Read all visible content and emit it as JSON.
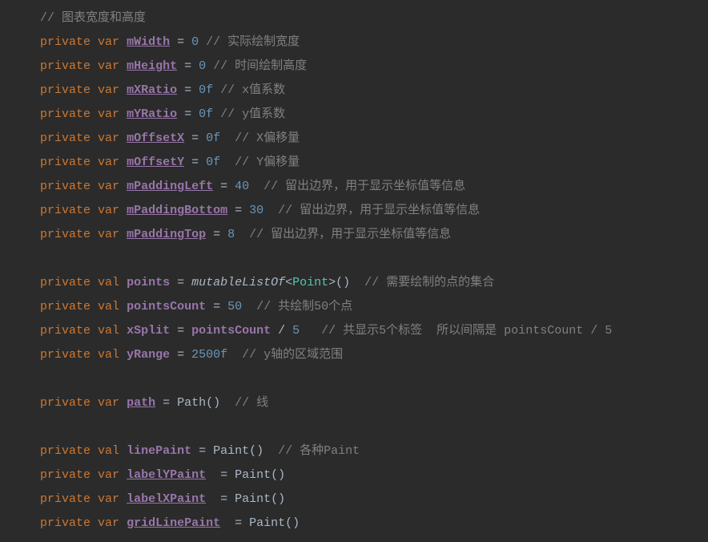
{
  "lines": [
    {
      "segments": [
        {
          "text": "// 图表宽度和高度",
          "cls": "comment"
        }
      ]
    },
    {
      "segments": [
        {
          "text": "private",
          "cls": "keyword"
        },
        {
          "text": " ",
          "cls": ""
        },
        {
          "text": "var",
          "cls": "keyword"
        },
        {
          "text": " ",
          "cls": ""
        },
        {
          "text": "mWidth",
          "cls": "purple underline bold"
        },
        {
          "text": " = ",
          "cls": "equals"
        },
        {
          "text": "0",
          "cls": "number"
        },
        {
          "text": " ",
          "cls": ""
        },
        {
          "text": "// 实际绘制宽度",
          "cls": "comment"
        }
      ]
    },
    {
      "segments": [
        {
          "text": "private",
          "cls": "keyword"
        },
        {
          "text": " ",
          "cls": ""
        },
        {
          "text": "var",
          "cls": "keyword"
        },
        {
          "text": " ",
          "cls": ""
        },
        {
          "text": "mHeight",
          "cls": "purple underline bold"
        },
        {
          "text": " = ",
          "cls": "equals"
        },
        {
          "text": "0",
          "cls": "number"
        },
        {
          "text": " ",
          "cls": ""
        },
        {
          "text": "// 时间绘制高度",
          "cls": "comment"
        }
      ]
    },
    {
      "segments": [
        {
          "text": "private",
          "cls": "keyword"
        },
        {
          "text": " ",
          "cls": ""
        },
        {
          "text": "var",
          "cls": "keyword"
        },
        {
          "text": " ",
          "cls": ""
        },
        {
          "text": "mXRatio",
          "cls": "purple underline bold"
        },
        {
          "text": " = ",
          "cls": "equals"
        },
        {
          "text": "0f",
          "cls": "number"
        },
        {
          "text": " ",
          "cls": ""
        },
        {
          "text": "// x值系数",
          "cls": "comment"
        }
      ]
    },
    {
      "segments": [
        {
          "text": "private",
          "cls": "keyword"
        },
        {
          "text": " ",
          "cls": ""
        },
        {
          "text": "var",
          "cls": "keyword"
        },
        {
          "text": " ",
          "cls": ""
        },
        {
          "text": "mYRatio",
          "cls": "purple underline bold"
        },
        {
          "text": " = ",
          "cls": "equals"
        },
        {
          "text": "0f",
          "cls": "number"
        },
        {
          "text": " ",
          "cls": ""
        },
        {
          "text": "// y值系数",
          "cls": "comment"
        }
      ]
    },
    {
      "segments": [
        {
          "text": "private",
          "cls": "keyword"
        },
        {
          "text": " ",
          "cls": ""
        },
        {
          "text": "var",
          "cls": "keyword"
        },
        {
          "text": " ",
          "cls": ""
        },
        {
          "text": "mOffsetX",
          "cls": "purple underline bold"
        },
        {
          "text": " = ",
          "cls": "equals"
        },
        {
          "text": "0f",
          "cls": "number"
        },
        {
          "text": "  ",
          "cls": ""
        },
        {
          "text": "// X偏移量",
          "cls": "comment"
        }
      ]
    },
    {
      "segments": [
        {
          "text": "private",
          "cls": "keyword"
        },
        {
          "text": " ",
          "cls": ""
        },
        {
          "text": "var",
          "cls": "keyword"
        },
        {
          "text": " ",
          "cls": ""
        },
        {
          "text": "mOffsetY",
          "cls": "purple underline bold"
        },
        {
          "text": " = ",
          "cls": "equals"
        },
        {
          "text": "0f",
          "cls": "number"
        },
        {
          "text": "  ",
          "cls": ""
        },
        {
          "text": "// Y偏移量",
          "cls": "comment"
        }
      ]
    },
    {
      "segments": [
        {
          "text": "private",
          "cls": "keyword"
        },
        {
          "text": " ",
          "cls": ""
        },
        {
          "text": "var",
          "cls": "keyword"
        },
        {
          "text": " ",
          "cls": ""
        },
        {
          "text": "mPaddingLeft",
          "cls": "purple underline bold"
        },
        {
          "text": " = ",
          "cls": "equals"
        },
        {
          "text": "40",
          "cls": "number"
        },
        {
          "text": "  ",
          "cls": ""
        },
        {
          "text": "// 留出边界，用于显示坐标值等信息",
          "cls": "comment"
        }
      ]
    },
    {
      "segments": [
        {
          "text": "private",
          "cls": "keyword"
        },
        {
          "text": " ",
          "cls": ""
        },
        {
          "text": "var",
          "cls": "keyword"
        },
        {
          "text": " ",
          "cls": ""
        },
        {
          "text": "mPaddingBottom",
          "cls": "purple underline bold"
        },
        {
          "text": " = ",
          "cls": "equals"
        },
        {
          "text": "30",
          "cls": "number"
        },
        {
          "text": "  ",
          "cls": ""
        },
        {
          "text": "// 留出边界，用于显示坐标值等信息",
          "cls": "comment"
        }
      ]
    },
    {
      "segments": [
        {
          "text": "private",
          "cls": "keyword"
        },
        {
          "text": " ",
          "cls": ""
        },
        {
          "text": "var",
          "cls": "keyword"
        },
        {
          "text": " ",
          "cls": ""
        },
        {
          "text": "mPaddingTop",
          "cls": "purple underline bold"
        },
        {
          "text": " = ",
          "cls": "equals"
        },
        {
          "text": "8",
          "cls": "number"
        },
        {
          "text": "  ",
          "cls": ""
        },
        {
          "text": "// 留出边界，用于显示坐标值等信息",
          "cls": "comment"
        }
      ]
    },
    {
      "segments": [
        {
          "text": "",
          "cls": ""
        }
      ]
    },
    {
      "segments": [
        {
          "text": "private",
          "cls": "keyword"
        },
        {
          "text": " ",
          "cls": ""
        },
        {
          "text": "val",
          "cls": "keyword"
        },
        {
          "text": " ",
          "cls": ""
        },
        {
          "text": "points",
          "cls": "purple bold"
        },
        {
          "text": " = ",
          "cls": "equals"
        },
        {
          "text": "mutableListOf",
          "cls": "italic"
        },
        {
          "text": "<",
          "cls": ""
        },
        {
          "text": "Point",
          "cls": "type"
        },
        {
          "text": ">()  ",
          "cls": ""
        },
        {
          "text": "// 需要绘制的点的集合",
          "cls": "comment"
        }
      ]
    },
    {
      "segments": [
        {
          "text": "private",
          "cls": "keyword"
        },
        {
          "text": " ",
          "cls": ""
        },
        {
          "text": "val",
          "cls": "keyword"
        },
        {
          "text": " ",
          "cls": ""
        },
        {
          "text": "pointsCount",
          "cls": "purple bold"
        },
        {
          "text": " = ",
          "cls": "equals"
        },
        {
          "text": "50",
          "cls": "number"
        },
        {
          "text": "  ",
          "cls": ""
        },
        {
          "text": "// 共绘制50个点",
          "cls": "comment"
        }
      ]
    },
    {
      "segments": [
        {
          "text": "private",
          "cls": "keyword"
        },
        {
          "text": " ",
          "cls": ""
        },
        {
          "text": "val",
          "cls": "keyword"
        },
        {
          "text": " ",
          "cls": ""
        },
        {
          "text": "xSplit",
          "cls": "purple bold"
        },
        {
          "text": " = ",
          "cls": "equals"
        },
        {
          "text": "pointsCount",
          "cls": "purple bold"
        },
        {
          "text": " / ",
          "cls": ""
        },
        {
          "text": "5",
          "cls": "number"
        },
        {
          "text": "   ",
          "cls": ""
        },
        {
          "text": "// 共显示5个标签  所以间隔是 pointsCount / 5",
          "cls": "comment"
        }
      ]
    },
    {
      "segments": [
        {
          "text": "private",
          "cls": "keyword"
        },
        {
          "text": " ",
          "cls": ""
        },
        {
          "text": "val",
          "cls": "keyword"
        },
        {
          "text": " ",
          "cls": ""
        },
        {
          "text": "yRange",
          "cls": "purple bold"
        },
        {
          "text": " = ",
          "cls": "equals"
        },
        {
          "text": "2500f",
          "cls": "number"
        },
        {
          "text": "  ",
          "cls": ""
        },
        {
          "text": "// y轴的区域范围",
          "cls": "comment"
        }
      ]
    },
    {
      "segments": [
        {
          "text": "",
          "cls": ""
        }
      ]
    },
    {
      "segments": [
        {
          "text": "private",
          "cls": "keyword"
        },
        {
          "text": " ",
          "cls": ""
        },
        {
          "text": "var",
          "cls": "keyword"
        },
        {
          "text": " ",
          "cls": ""
        },
        {
          "text": "path",
          "cls": "purple underline bold"
        },
        {
          "text": " = Path()  ",
          "cls": ""
        },
        {
          "text": "// 线",
          "cls": "comment"
        }
      ]
    },
    {
      "segments": [
        {
          "text": "",
          "cls": ""
        }
      ]
    },
    {
      "segments": [
        {
          "text": "private",
          "cls": "keyword"
        },
        {
          "text": " ",
          "cls": ""
        },
        {
          "text": "val",
          "cls": "keyword"
        },
        {
          "text": " ",
          "cls": ""
        },
        {
          "text": "linePaint",
          "cls": "purple bold"
        },
        {
          "text": " = Paint()  ",
          "cls": ""
        },
        {
          "text": "// 各种Paint",
          "cls": "comment"
        }
      ]
    },
    {
      "segments": [
        {
          "text": "private",
          "cls": "keyword"
        },
        {
          "text": " ",
          "cls": ""
        },
        {
          "text": "var",
          "cls": "keyword"
        },
        {
          "text": " ",
          "cls": ""
        },
        {
          "text": "labelYPaint",
          "cls": "purple underline bold"
        },
        {
          "text": "  = Paint()",
          "cls": ""
        }
      ]
    },
    {
      "segments": [
        {
          "text": "private",
          "cls": "keyword"
        },
        {
          "text": " ",
          "cls": ""
        },
        {
          "text": "var",
          "cls": "keyword"
        },
        {
          "text": " ",
          "cls": ""
        },
        {
          "text": "labelXPaint",
          "cls": "purple underline bold"
        },
        {
          "text": "  = Paint()",
          "cls": ""
        }
      ]
    },
    {
      "segments": [
        {
          "text": "private",
          "cls": "keyword"
        },
        {
          "text": " ",
          "cls": ""
        },
        {
          "text": "var",
          "cls": "keyword"
        },
        {
          "text": " ",
          "cls": ""
        },
        {
          "text": "gridLinePaint",
          "cls": "purple underline bold"
        },
        {
          "text": "  = Paint()",
          "cls": ""
        }
      ]
    }
  ]
}
